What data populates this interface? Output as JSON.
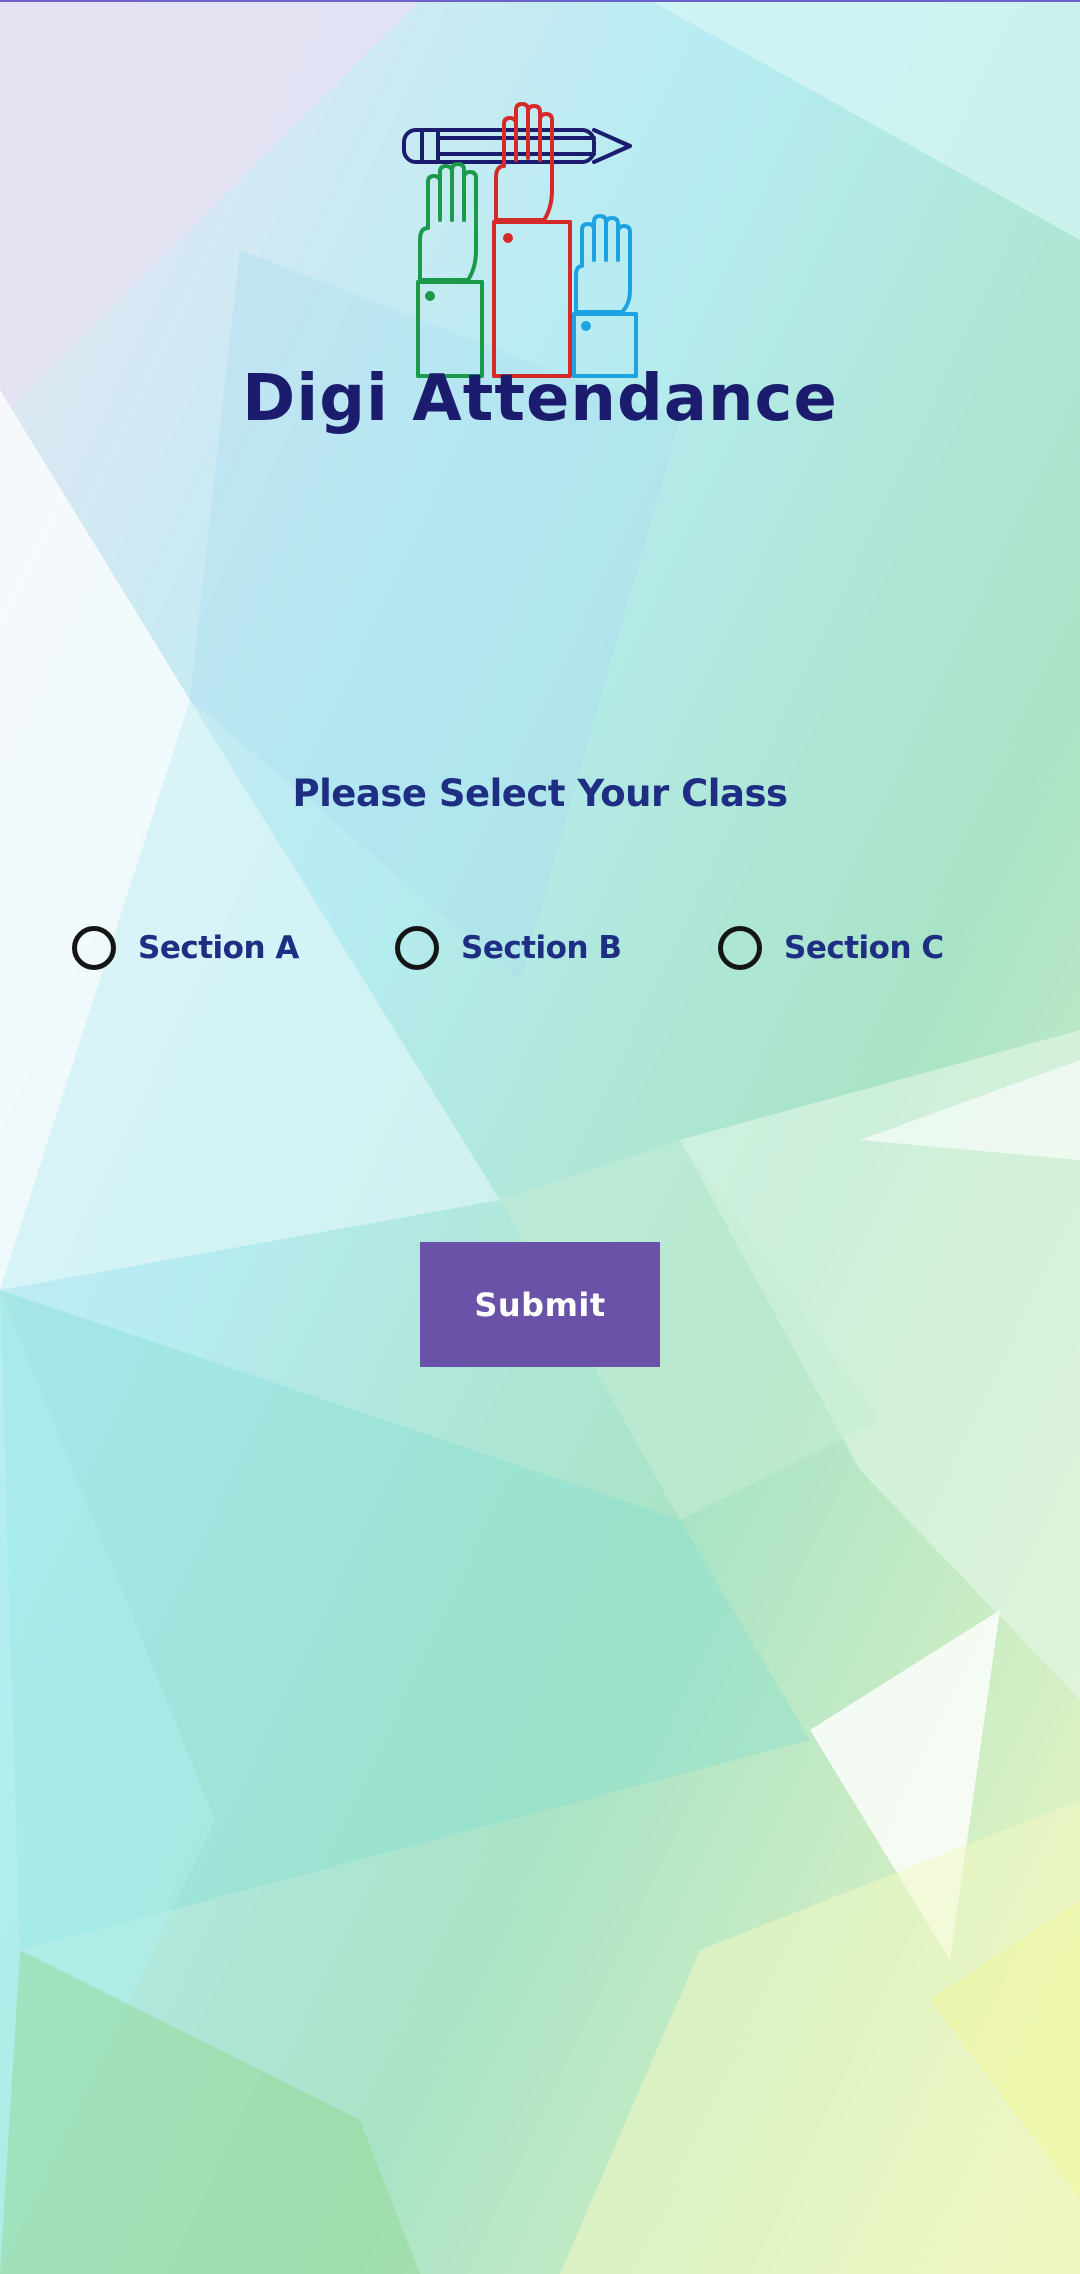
{
  "app": {
    "name": "Digi Attendance",
    "logo_icon": "raised-hands-pencil-icon"
  },
  "form": {
    "prompt": "Please Select Your Class",
    "options": [
      {
        "label": "Section A",
        "selected": false
      },
      {
        "label": "Section B",
        "selected": false
      },
      {
        "label": "Section C",
        "selected": false
      }
    ],
    "submit_label": "Submit"
  },
  "colors": {
    "title": "#1b1c6e",
    "text": "#1d2e83",
    "button": "#6a52a8",
    "button_text": "#ffffff",
    "hand_green": "#1a9a4a",
    "hand_red": "#d42a2a",
    "hand_blue": "#1fa3e0",
    "pencil": "#1b1c6e"
  }
}
